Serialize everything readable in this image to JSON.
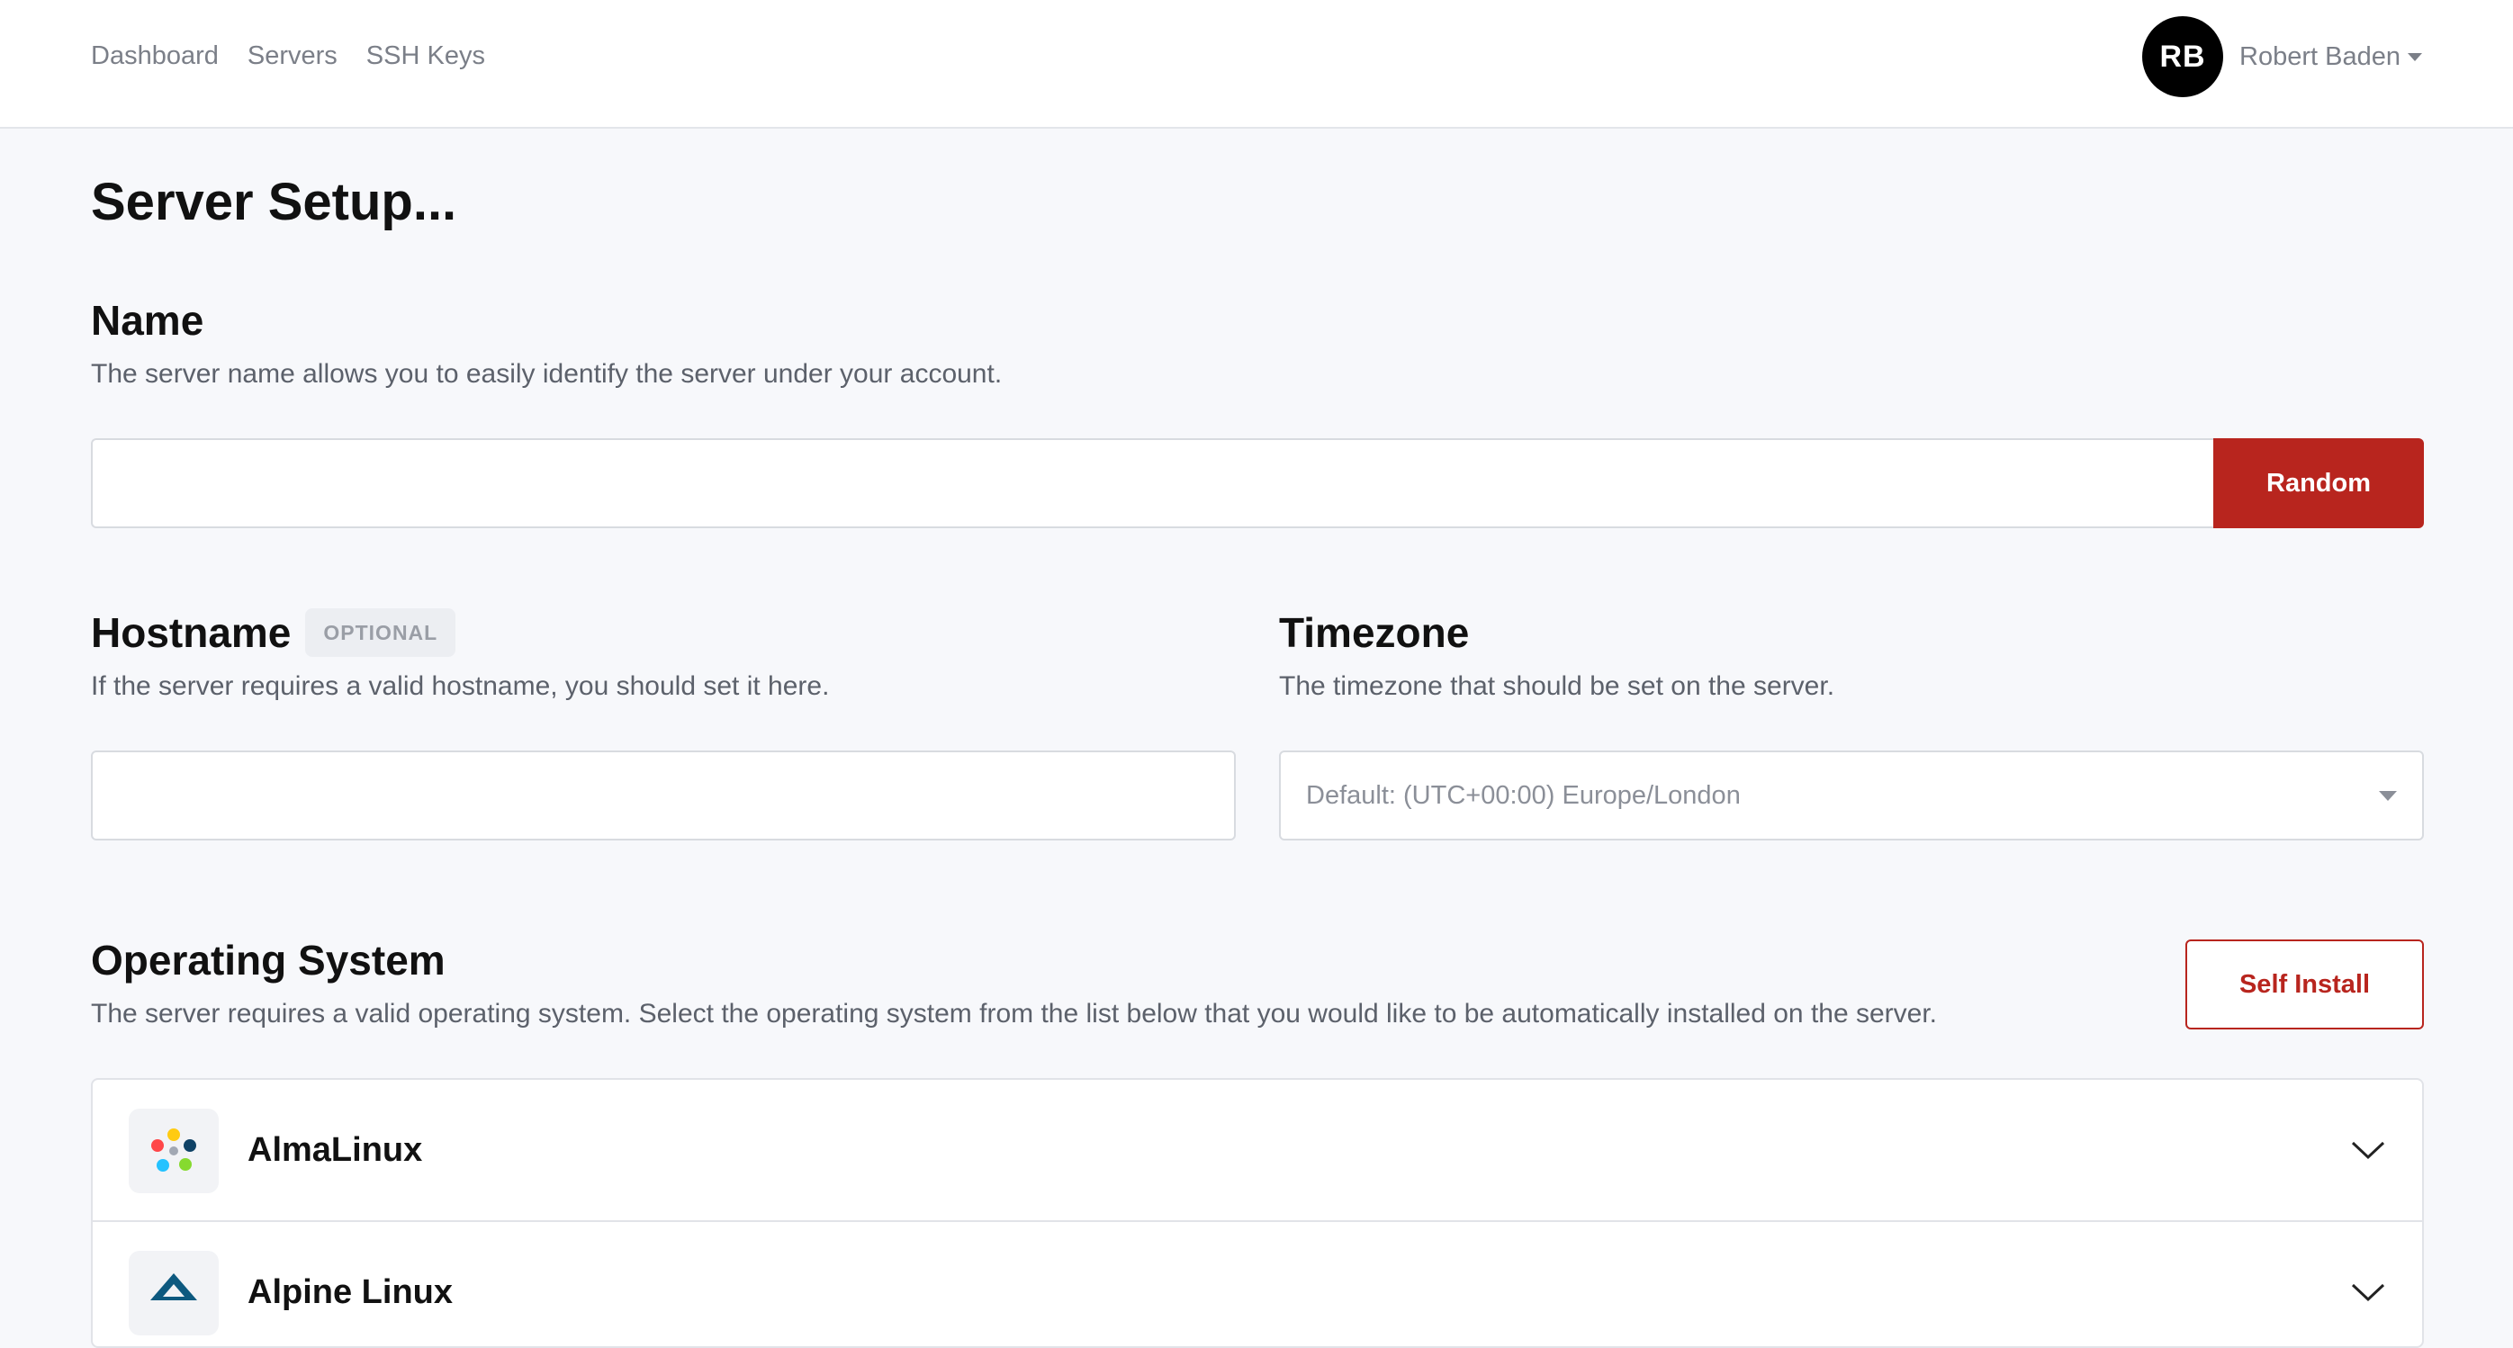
{
  "nav": {
    "items": [
      "Dashboard",
      "Servers",
      "SSH Keys"
    ]
  },
  "user": {
    "initials": "RB",
    "name": "Robert Baden"
  },
  "page": {
    "title": "Server Setup..."
  },
  "name_section": {
    "title": "Name",
    "description": "The server name allows you to easily identify the server under your account.",
    "value": "",
    "random_label": "Random"
  },
  "hostname_section": {
    "title": "Hostname",
    "badge": "OPTIONAL",
    "description": "If the server requires a valid hostname, you should set it here.",
    "value": ""
  },
  "timezone_section": {
    "title": "Timezone",
    "description": "The timezone that should be set on the server.",
    "selected": "Default: (UTC+00:00) Europe/London"
  },
  "os_section": {
    "title": "Operating System",
    "description": "The server requires a valid operating system. Select the operating system from the list below that you would like to be automatically installed on the server.",
    "self_install_label": "Self Install",
    "items": [
      {
        "name": "AlmaLinux",
        "icon": "almalinux-logo-icon"
      },
      {
        "name": "Alpine Linux",
        "icon": "alpine-linux-logo-icon"
      }
    ]
  },
  "colors": {
    "accent": "#b8251e",
    "background": "#f7f8fb"
  }
}
